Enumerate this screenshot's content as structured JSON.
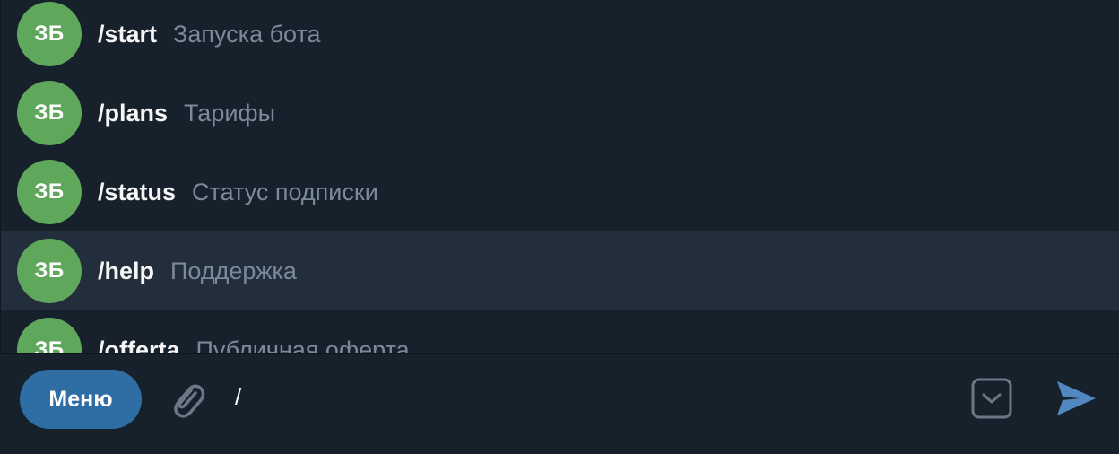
{
  "commands": [
    {
      "avatar": "ЗБ",
      "name": "/start",
      "description": "Запуска бота",
      "highlighted": false
    },
    {
      "avatar": "ЗБ",
      "name": "/plans",
      "description": "Тарифы",
      "highlighted": false
    },
    {
      "avatar": "ЗБ",
      "name": "/status",
      "description": "Статус подписки",
      "highlighted": false
    },
    {
      "avatar": "ЗБ",
      "name": "/help",
      "description": "Поддержка",
      "highlighted": true
    },
    {
      "avatar": "ЗБ",
      "name": "/offerta",
      "description": "Публичная оферта",
      "highlighted": false
    }
  ],
  "input_bar": {
    "menu_label": "Меню",
    "message_value": "/",
    "attach_icon": "paperclip-icon",
    "keyboard_icon": "chevron-down-square-icon",
    "send_icon": "send-icon"
  },
  "colors": {
    "background": "#17212b",
    "highlight_row": "#232e3c",
    "avatar": "#5fa75a",
    "menu_button": "#2f6ea5",
    "send_accent": "#5288c1",
    "muted_text": "#7b8a9a"
  }
}
